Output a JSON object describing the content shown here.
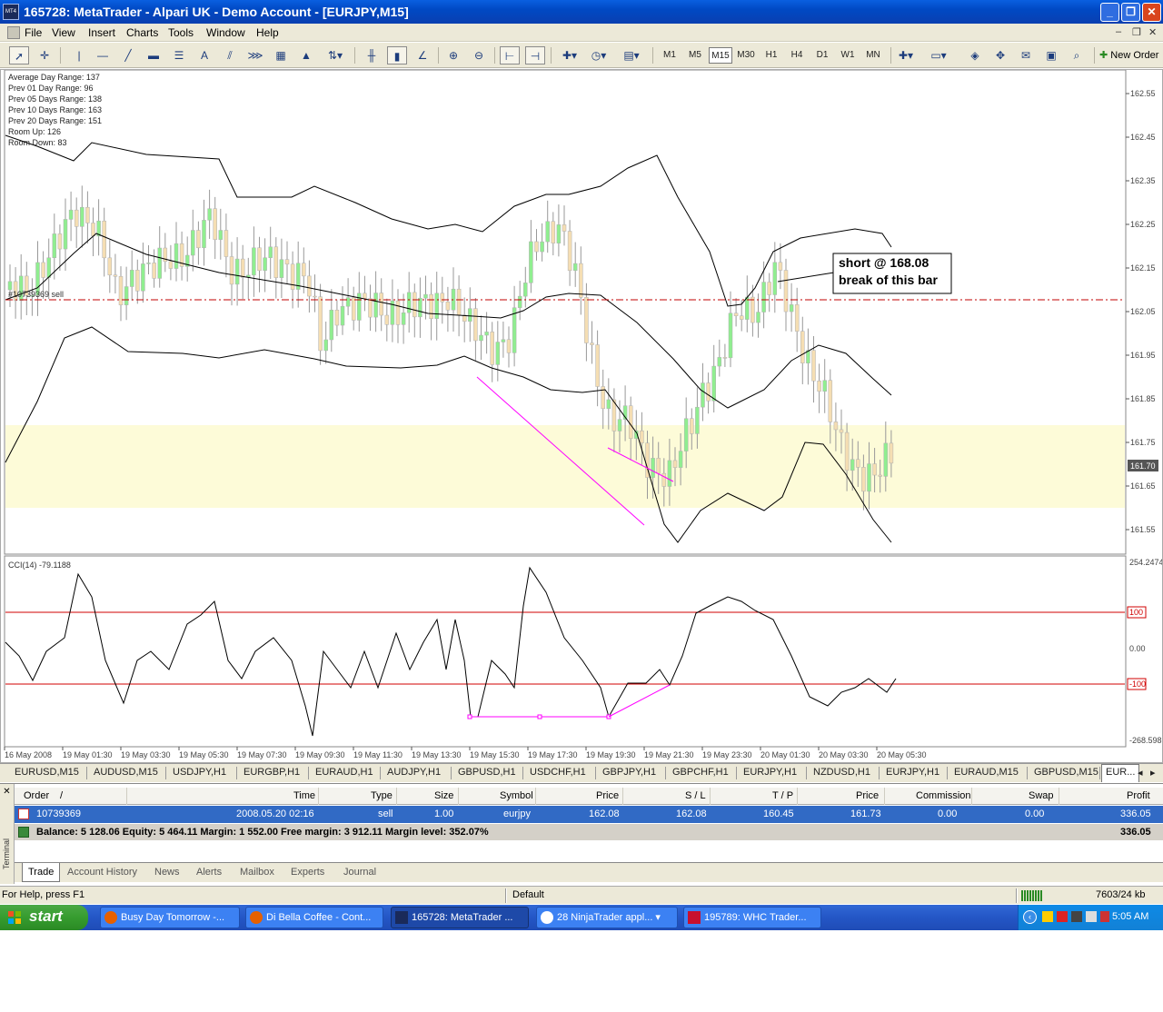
{
  "window": {
    "title": "165728: MetaTrader - Alpari UK - Demo Account - [EURJPY,M15]",
    "app_icon_text": "MT4"
  },
  "menu": [
    "File",
    "View",
    "Insert",
    "Charts",
    "Tools",
    "Window",
    "Help"
  ],
  "toolbar": {
    "timeframes": [
      "M1",
      "M5",
      "M15",
      "M30",
      "H1",
      "H4",
      "D1",
      "W1",
      "MN"
    ],
    "active_timeframe": "M15",
    "new_order_label": "New Order"
  },
  "chart": {
    "stats": [
      "Average Day  Range: 137",
      "Prev 01  Day  Range: 96",
      "Prev 05  Days Range: 138",
      "Prev 10  Days Range: 163",
      "Prev 20  Days Range: 151",
      "Room Up:      126",
      "Room Down: 83"
    ],
    "order_line_label": "#10739369 sell",
    "annotation": [
      "short @ 168.08",
      "break of this bar"
    ],
    "price_axis": [
      "162.55",
      "162.45",
      "162.35",
      "162.25",
      "162.15",
      "162.05",
      "161.95",
      "161.85",
      "161.75",
      "161.65",
      "161.55"
    ],
    "current_price": "161.70",
    "indicator_label": "CCI(14) -79.1188",
    "indicator_axis": [
      "254.2474",
      "100",
      "0.00",
      "-100",
      "-268.598"
    ],
    "time_axis": [
      "16 May 2008",
      "19 May 01:30",
      "19 May 03:30",
      "19 May 05:30",
      "19 May 07:30",
      "19 May 09:30",
      "19 May 11:30",
      "19 May 13:30",
      "19 May 15:30",
      "19 May 17:30",
      "19 May 19:30",
      "19 May 21:30",
      "19 May 23:30",
      "20 May 01:30",
      "20 May 03:30",
      "20 May 05:30"
    ],
    "colors": {
      "bull": "#90ee90",
      "bear": "#f5deb3",
      "zone": "#fdfbd8",
      "order_line": "#c00000",
      "trendline": "#ff00ff",
      "cci_levels": "#d00000"
    }
  },
  "chart_tabs": [
    "EURUSD,M15",
    "AUDUSD,M15",
    "USDJPY,H1",
    "EURGBP,H1",
    "EURAUD,H1",
    "AUDJPY,H1",
    "GBPUSD,H1",
    "USDCHF,H1",
    "GBPJPY,H1",
    "GBPCHF,H1",
    "EURJPY,H1",
    "NZDUSD,H1",
    "EURJPY,H1",
    "EURAUD,M15",
    "GBPUSD,M15",
    "EUR..."
  ],
  "terminal": {
    "side_label": "Terminal",
    "columns": [
      "Order",
      "/",
      "Time",
      "Type",
      "Size",
      "Symbol",
      "Price",
      "S / L",
      "T / P",
      "Price",
      "Commission",
      "Swap",
      "Profit"
    ],
    "row": {
      "order": "10739369",
      "time": "2008.05.20 02:16",
      "type": "sell",
      "size": "1.00",
      "symbol": "eurjpy",
      "price": "162.08",
      "sl": "162.08",
      "tp": "160.45",
      "cur_price": "161.73",
      "commission": "0.00",
      "swap": "0.00",
      "profit": "336.05"
    },
    "balance_line": "Balance: 5 128.06  Equity: 5 464.11  Margin: 1 552.00  Free margin: 3 912.11  Margin level: 352.07%",
    "balance_profit": "336.05",
    "tabs": [
      "Trade",
      "Account History",
      "News",
      "Alerts",
      "Mailbox",
      "Experts",
      "Journal"
    ]
  },
  "status": {
    "help": "For Help, press F1",
    "profile": "Default",
    "traffic": "7603/24 kb"
  },
  "taskbar": {
    "start": "start",
    "tasks": [
      "Busy Day Tomorrow -...",
      "Di Bella Coffee - Cont...",
      "165728: MetaTrader ...",
      "28 NinjaTrader appl...",
      "195789: WHC Trader..."
    ],
    "clock": "5:05 AM"
  }
}
